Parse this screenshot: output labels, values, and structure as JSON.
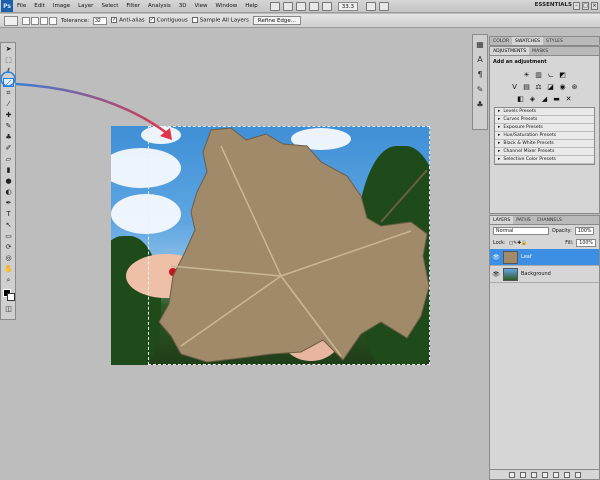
{
  "app": {
    "logo": "Ps",
    "zoom": "33.3",
    "workspace": "ESSENTIALS"
  },
  "menu": [
    "File",
    "Edit",
    "Image",
    "Layer",
    "Select",
    "Filter",
    "Analysis",
    "3D",
    "View",
    "Window",
    "Help"
  ],
  "options": {
    "tolerance_label": "Tolerance:",
    "tolerance_value": "32",
    "antialias_label": "Anti-alias",
    "contiguous_label": "Contiguous",
    "sample_all_label": "Sample All Layers",
    "refine_edge_label": "Refine Edge..."
  },
  "panels": {
    "color_tabs": [
      "COLOR",
      "SWATCHES",
      "STYLES"
    ],
    "adjust_tabs": [
      "ADJUSTMENTS",
      "MASKS"
    ],
    "adjust_title": "Add an adjustment",
    "presets": [
      "Levels Presets",
      "Curves Presets",
      "Exposure Presets",
      "Hue/Saturation Presets",
      "Black & White Presets",
      "Channel Mixer Presets",
      "Selective Color Presets"
    ],
    "layer_tabs": [
      "LAYERS",
      "PATHS",
      "CHANNELS"
    ],
    "blend_mode": "Normal",
    "opacity_label": "Opacity:",
    "opacity_value": "100%",
    "lock_label": "Lock:",
    "fill_label": "Fill:",
    "fill_value": "100%",
    "layers": [
      {
        "name": "Leaf",
        "selected": true
      },
      {
        "name": "Background",
        "selected": false
      }
    ]
  }
}
